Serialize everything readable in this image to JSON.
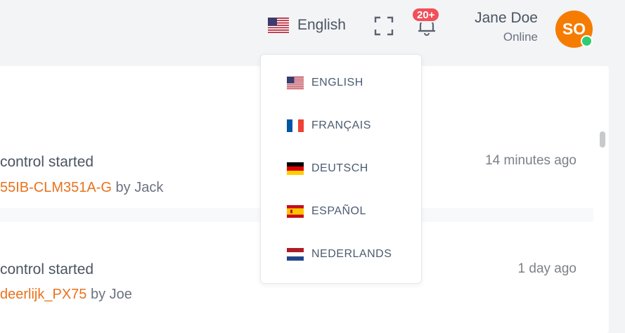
{
  "header": {
    "language": {
      "label": "English",
      "flag_icon": "us-flag-icon"
    },
    "notifications": {
      "badge": "20+"
    },
    "user": {
      "name": "Jane Doe",
      "status": "Online",
      "initials": "SO"
    }
  },
  "language_menu": {
    "items": [
      {
        "label": "ENGLISH",
        "flag_icon": "us-flag-icon"
      },
      {
        "label": "FRANÇAIS",
        "flag_icon": "fr-flag-icon"
      },
      {
        "label": "DEUTSCH",
        "flag_icon": "de-flag-icon"
      },
      {
        "label": "ESPAÑOL",
        "flag_icon": "es-flag-icon"
      },
      {
        "label": "NEDERLANDS",
        "flag_icon": "nl-flag-icon"
      }
    ]
  },
  "activities": [
    {
      "title": "control started",
      "link": "55IB-CLM351A-G",
      "by": "by Jack",
      "time": "14 minutes ago"
    },
    {
      "title": "control started",
      "link": "deerlijk_PX75",
      "by": "by Joe",
      "time": "1 day ago"
    }
  ],
  "colors": {
    "accent": "#e8721c",
    "badge": "#f1505a",
    "avatar": "#f57c00",
    "online": "#2ecc71"
  }
}
